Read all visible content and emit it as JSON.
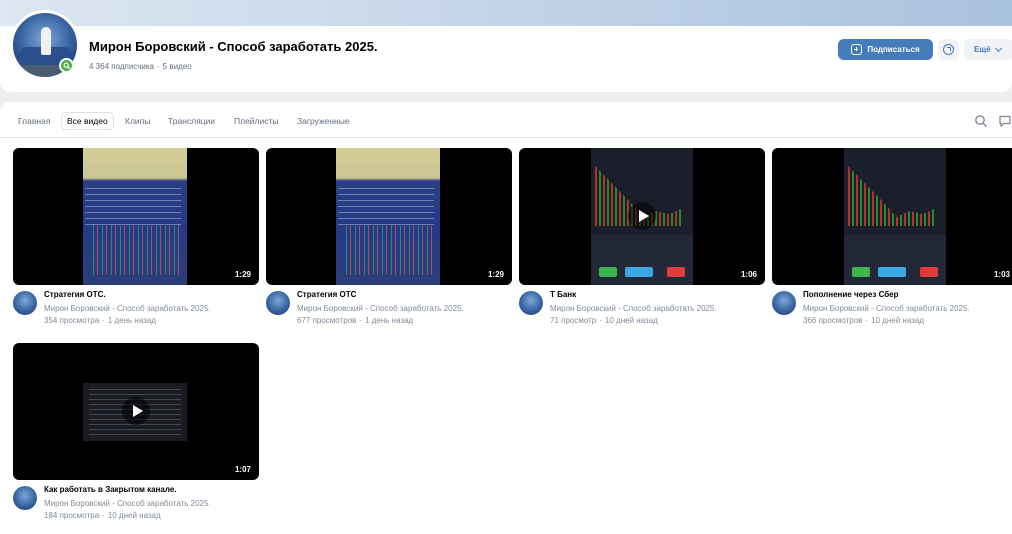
{
  "channel": {
    "name": "Мирон Боровский - Способ заработать 2025.",
    "subscribers": "4 364 подписчика",
    "videos_count": "5 видео",
    "subscribe_label": "Подписаться",
    "more_label": "Ещё"
  },
  "tabs": [
    {
      "label": "Главная",
      "active": false
    },
    {
      "label": "Все видео",
      "active": true
    },
    {
      "label": "Клипы",
      "active": false
    },
    {
      "label": "Трансляции",
      "active": false
    },
    {
      "label": "Плейлисты",
      "active": false
    },
    {
      "label": "Загруженные",
      "active": false
    }
  ],
  "videos": [
    {
      "title": "Стратегия OTC.",
      "channel": "Мирон Боровский - Способ заработать 2025.",
      "views": "354 просмотра",
      "age": "1 день назад",
      "duration": "1:29",
      "thumb": "monitor"
    },
    {
      "title": "Стратегия OTC",
      "channel": "Мирон Боровский - Способ заработать 2025.",
      "views": "677 просмотров",
      "age": "1 день назад",
      "duration": "1:29",
      "thumb": "monitor"
    },
    {
      "title": "Т Банк",
      "channel": "Мирон Боровский - Способ заработать 2025.",
      "views": "71 просмотр",
      "age": "10 дней назад",
      "duration": "1:06",
      "thumb": "phone"
    },
    {
      "title": "Пополнение через Сбер",
      "channel": "Мирон Боровский - Способ заработать 2025.",
      "views": "366 просмотров",
      "age": "10 дней назад",
      "duration": "1:03",
      "thumb": "phone"
    },
    {
      "title": "Как работать в Закрытом канале.",
      "channel": "Мирон Боровский - Способ заработать 2025.",
      "views": "184 просмотра",
      "age": "10 дней назад",
      "duration": "1:07",
      "thumb": "screen"
    }
  ],
  "icons": {
    "search": "search-icon",
    "comment": "comment-icon",
    "share": "share-icon",
    "verified": "search-badge-icon"
  },
  "colors": {
    "accent": "#447bba",
    "muted_text": "#818c99",
    "badge_green": "#4bb34b"
  }
}
